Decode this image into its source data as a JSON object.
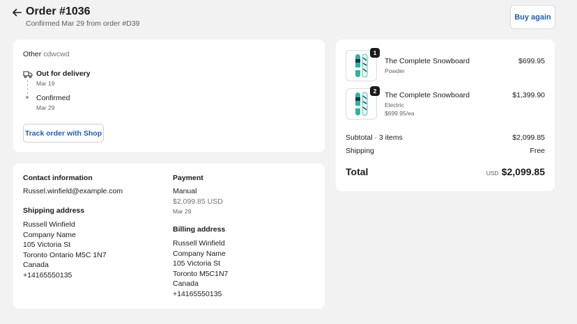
{
  "header": {
    "title": "Order #1036",
    "subtitle": "Confirmed Mar 29 from order #D39",
    "buy_again_label": "Buy again"
  },
  "status": {
    "shipping_type_label": "Other",
    "shipping_type_value": "cdwcwd",
    "events": [
      {
        "label": "Out for delivery",
        "date": "Mar 19",
        "icon": "truck-icon"
      },
      {
        "label": "Confirmed",
        "date": "Mar 29",
        "icon": "dot-icon"
      }
    ],
    "track_label": "Track order with Shop"
  },
  "info": {
    "contact_heading": "Contact information",
    "contact_email": "Russel.winfield@example.com",
    "shipping_heading": "Shipping address",
    "shipping_lines": [
      "Russell Winfield",
      "Company Name",
      "105 Victoria St",
      "Toronto Ontario M5C 1N7",
      "Canada",
      "+14165550135"
    ],
    "payment_heading": "Payment",
    "payment_method": "Manual",
    "payment_amount": "$2,099.85 USD",
    "payment_date": "Mar 29",
    "billing_heading": "Billing address",
    "billing_lines": [
      "Russell Winfield",
      "Company Name",
      "105 Victoria St",
      "Toronto M5C1N7",
      "Canada",
      "+14165550135"
    ]
  },
  "summary": {
    "items": [
      {
        "name": "The Complete Snowboard",
        "variant": "Powder",
        "unit_price": "",
        "price": "$699.95",
        "quantity": "1"
      },
      {
        "name": "The Complete Snowboard",
        "variant": "Electric",
        "unit_price": "$699.95/ea",
        "price": "$1,399.90",
        "quantity": "2"
      }
    ],
    "subtotal_label": "Subtotal · 3 items",
    "subtotal_value": "$2,099.85",
    "shipping_label": "Shipping",
    "shipping_value": "Free",
    "total_label": "Total",
    "total_currency": "USD",
    "total_value": "$2,099.85"
  },
  "colors": {
    "accent": "#1a5fb4",
    "background": "#f2f2f2",
    "card": "#ffffff"
  }
}
